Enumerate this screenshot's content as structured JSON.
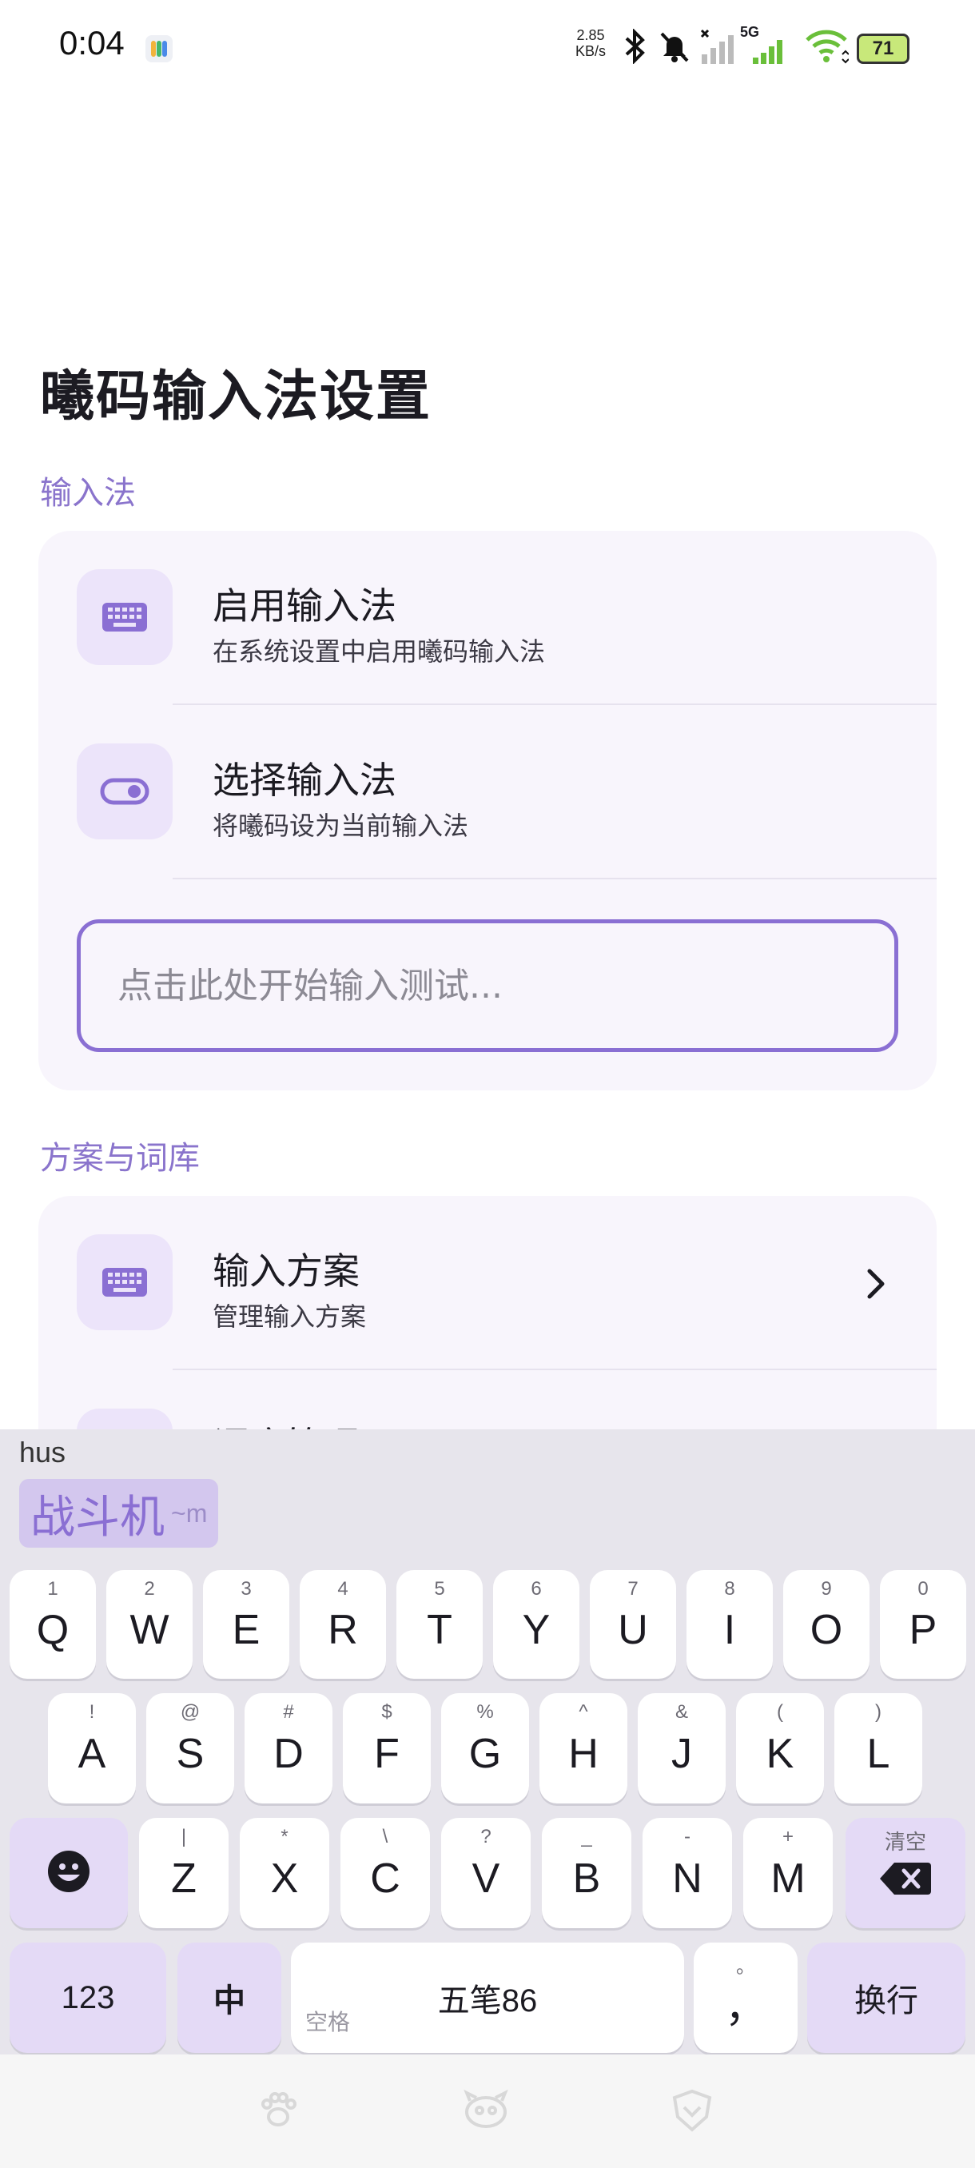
{
  "status_bar": {
    "time": "0:04",
    "net_speed_value": "2.85",
    "net_speed_unit": "KB/s",
    "network_type": "5G",
    "battery": "71",
    "icons": [
      "bluetooth-icon",
      "mute-icon",
      "signal-icon",
      "wifi-icon",
      "battery-icon"
    ]
  },
  "page": {
    "title": "曦码输入法设置"
  },
  "section_input": {
    "label": "输入法",
    "rows": [
      {
        "title": "启用输入法",
        "subtitle": "在系统设置中启用曦码输入法",
        "icon": "keyboard-icon"
      },
      {
        "title": "选择输入法",
        "subtitle": "将曦码设为当前输入法",
        "icon": "toggle-icon"
      }
    ],
    "test_placeholder": "点击此处开始输入测试..."
  },
  "section_schema": {
    "label": "方案与词库",
    "rows": [
      {
        "title": "输入方案",
        "subtitle": "管理输入方案",
        "icon": "keyboard-icon"
      },
      {
        "title": "词库管理",
        "subtitle": "",
        "icon": "book-icon"
      }
    ]
  },
  "keyboard": {
    "composing": "hus",
    "candidate_text": "战斗机",
    "candidate_hint": "~m",
    "row1": [
      {
        "key": "Q",
        "hint": "1"
      },
      {
        "key": "W",
        "hint": "2"
      },
      {
        "key": "E",
        "hint": "3"
      },
      {
        "key": "R",
        "hint": "4"
      },
      {
        "key": "T",
        "hint": "5"
      },
      {
        "key": "Y",
        "hint": "6"
      },
      {
        "key": "U",
        "hint": "7"
      },
      {
        "key": "I",
        "hint": "8"
      },
      {
        "key": "O",
        "hint": "9"
      },
      {
        "key": "P",
        "hint": "0"
      }
    ],
    "row2": [
      {
        "key": "A",
        "hint": "!"
      },
      {
        "key": "S",
        "hint": "@"
      },
      {
        "key": "D",
        "hint": "#"
      },
      {
        "key": "F",
        "hint": "$"
      },
      {
        "key": "G",
        "hint": "%"
      },
      {
        "key": "H",
        "hint": "^"
      },
      {
        "key": "J",
        "hint": "&"
      },
      {
        "key": "K",
        "hint": "("
      },
      {
        "key": "L",
        "hint": ")"
      }
    ],
    "row3": [
      {
        "key": "Z",
        "hint": "|"
      },
      {
        "key": "X",
        "hint": "*"
      },
      {
        "key": "C",
        "hint": "\\"
      },
      {
        "key": "V",
        "hint": "?"
      },
      {
        "key": "B",
        "hint": "_"
      },
      {
        "key": "N",
        "hint": "-"
      },
      {
        "key": "M",
        "hint": "+"
      }
    ],
    "backspace_hint": "清空",
    "num_key": "123",
    "lang_key": "中",
    "space_label": "五笔86",
    "space_hint": "空格",
    "comma_key": "，",
    "comma_hint": "。",
    "enter_key": "换行"
  },
  "nav_bar": {
    "icons": [
      "paw-icon",
      "mascot-icon",
      "shield-icon"
    ]
  },
  "colors": {
    "accent": "#8a6fd3",
    "section_label": "#8a74cc",
    "card_bg": "#f8f5fc",
    "icon_bg": "#ece4fa",
    "keyboard_bg": "#e7e5ec",
    "func_key_bg": "#e4daf6"
  }
}
